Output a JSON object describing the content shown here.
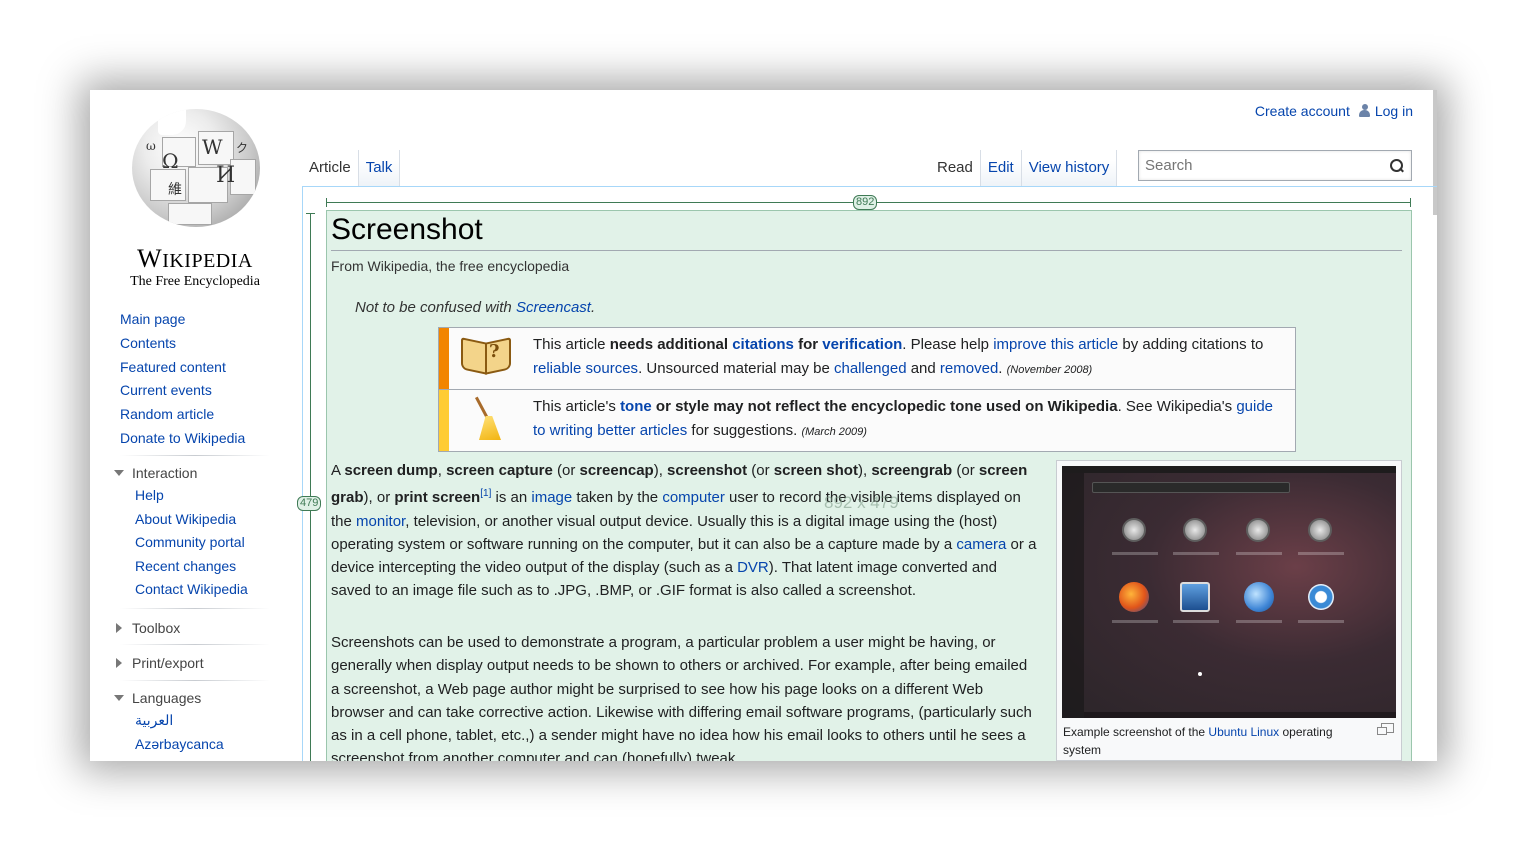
{
  "personal": {
    "create_account": "Create account",
    "log_in": "Log in"
  },
  "logo": {
    "wordmark_first": "W",
    "wordmark_rest": "IKIPEDIA",
    "tagline": "The Free Encyclopedia",
    "glyphs": [
      "W",
      "Ω",
      "И",
      "維",
      "ω",
      "ク"
    ]
  },
  "navigation": [
    "Main page",
    "Contents",
    "Featured content",
    "Current events",
    "Random article",
    "Donate to Wikipedia"
  ],
  "interaction": {
    "heading": "Interaction",
    "items": [
      "Help",
      "About Wikipedia",
      "Community portal",
      "Recent changes",
      "Contact Wikipedia"
    ]
  },
  "toolbox": {
    "heading": "Toolbox"
  },
  "print_export": {
    "heading": "Print/export"
  },
  "languages": {
    "heading": "Languages",
    "items": [
      "العربية",
      "Azərbaycanca"
    ]
  },
  "tabs": {
    "article": "Article",
    "talk": "Talk",
    "read": "Read",
    "edit": "Edit",
    "view_history": "View history"
  },
  "search": {
    "placeholder": "Search"
  },
  "dimensions": {
    "width_tag": "892",
    "height_tag": "479",
    "overlay": "892 x 479"
  },
  "article": {
    "title": "Screenshot",
    "from": "From Wikipedia, the free encyclopedia",
    "hatnote_prefix": "Not to be confused with ",
    "hatnote_link": "Screencast",
    "hatnote_suffix": "."
  },
  "ambox1": {
    "t1": "This article ",
    "t2": "needs additional ",
    "link_citations": "citations",
    "t3": " for ",
    "link_verification": "verification",
    "t4": ". Please help ",
    "link_improve": "improve this article",
    "t5": " by adding citations to ",
    "link_reliable": "reliable sources",
    "t6": ". Unsourced material may be ",
    "link_challenged": "challenged",
    "t7": " and ",
    "link_removed": "removed",
    "t8": ". ",
    "date": "(November 2008)",
    "stripe_color": "#f28500"
  },
  "ambox2": {
    "t1": "This article's ",
    "link_tone": "tone",
    "t2": " or style may not reflect the encyclopedic tone used on Wikipedia",
    "t3": ". See Wikipedia's ",
    "link_guide": "guide to writing better articles",
    "t4": " for suggestions. ",
    "date": "(March 2009)",
    "stripe_color": "#fc3"
  },
  "para1": {
    "a": "A ",
    "b1": "screen dump",
    "c": ", ",
    "b2": "screen capture",
    "d": " (or ",
    "b3": "screencap",
    "e": "), ",
    "b4": "screenshot",
    "f": " (or ",
    "b5": "screen shot",
    "g": "), ",
    "b6": "screengrab",
    "h": " (or ",
    "b7": "screen grab",
    "i": "), or ",
    "b8": "print screen",
    "sup": "[1]",
    "j": " is an ",
    "link_image": "image",
    "k": " taken by the ",
    "link_computer": "computer",
    "l": " user to record the visible items displayed on the ",
    "link_monitor": "monitor",
    "m": ", television, or another visual output device. Usually this is a digital image using the (host) operating system or software running on the computer, but it can also be a capture made by a ",
    "link_camera": "camera",
    "n": " or a device intercepting the video output of the display (such as a ",
    "link_dvr": "DVR",
    "o": "). That latent image converted and saved to an image file such as to .JPG, .BMP, or .GIF format is also called a screenshot."
  },
  "para2": {
    "text": "Screenshots can be used to demonstrate a program, a particular problem a user might be having, or generally when display output needs to be shown to others or archived. For example, after being emailed a screenshot, a Web page author might be surprised to see how his page looks on a different Web browser and can take corrective action. Likewise with differing email software programs, (particularly such as in a cell phone, tablet, etc.,) a sender might have no idea how his email looks to others until he sees a screenshot from another computer and can (hopefully) tweak"
  },
  "thumb": {
    "caption_prefix": "Example screenshot of the ",
    "link_ubuntu": "Ubuntu",
    "caption_space": " ",
    "link_linux": "Linux",
    "caption_suffix": " operating system"
  },
  "colors": {
    "link": "#0645ad",
    "highlight": "#e1f2e8",
    "ruler": "#3f7a55"
  }
}
